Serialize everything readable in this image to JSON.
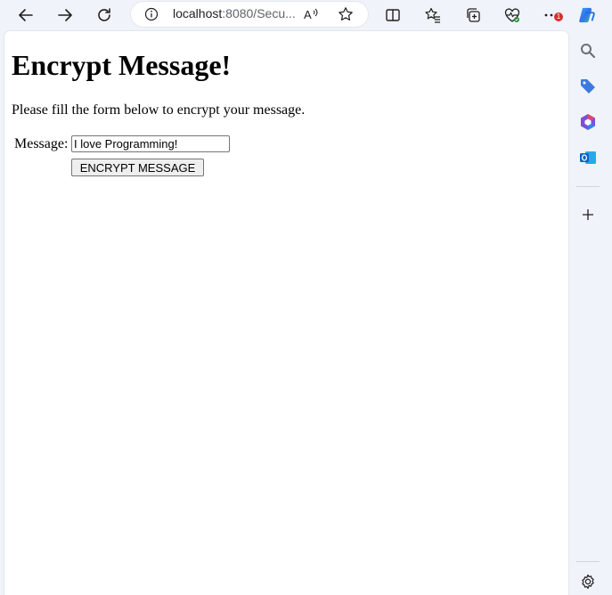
{
  "browser": {
    "url_host": "localhost",
    "url_rest": ":8080/Secu...",
    "notifications_badge": "1",
    "icons": [
      "back-arrow-icon",
      "forward-arrow-icon",
      "refresh-icon",
      "info-icon",
      "read-aloud-icon",
      "favorite-star-icon",
      "split-screen-icon",
      "favorites-icon",
      "collections-icon",
      "browser-essentials-icon",
      "more-icon",
      "copilot-icon"
    ]
  },
  "sidebar": {
    "icons": [
      "search-icon",
      "shopping-tag-icon",
      "office-icon",
      "outlook-icon",
      "add-icon",
      "settings-icon"
    ]
  },
  "page": {
    "title": "Encrypt Message!",
    "intro": "Please fill the form below to encrypt your message.",
    "form": {
      "message_label": "Message:",
      "message_value": "I love Programming!",
      "submit_label": "ENCRYPT MESSAGE"
    }
  }
}
